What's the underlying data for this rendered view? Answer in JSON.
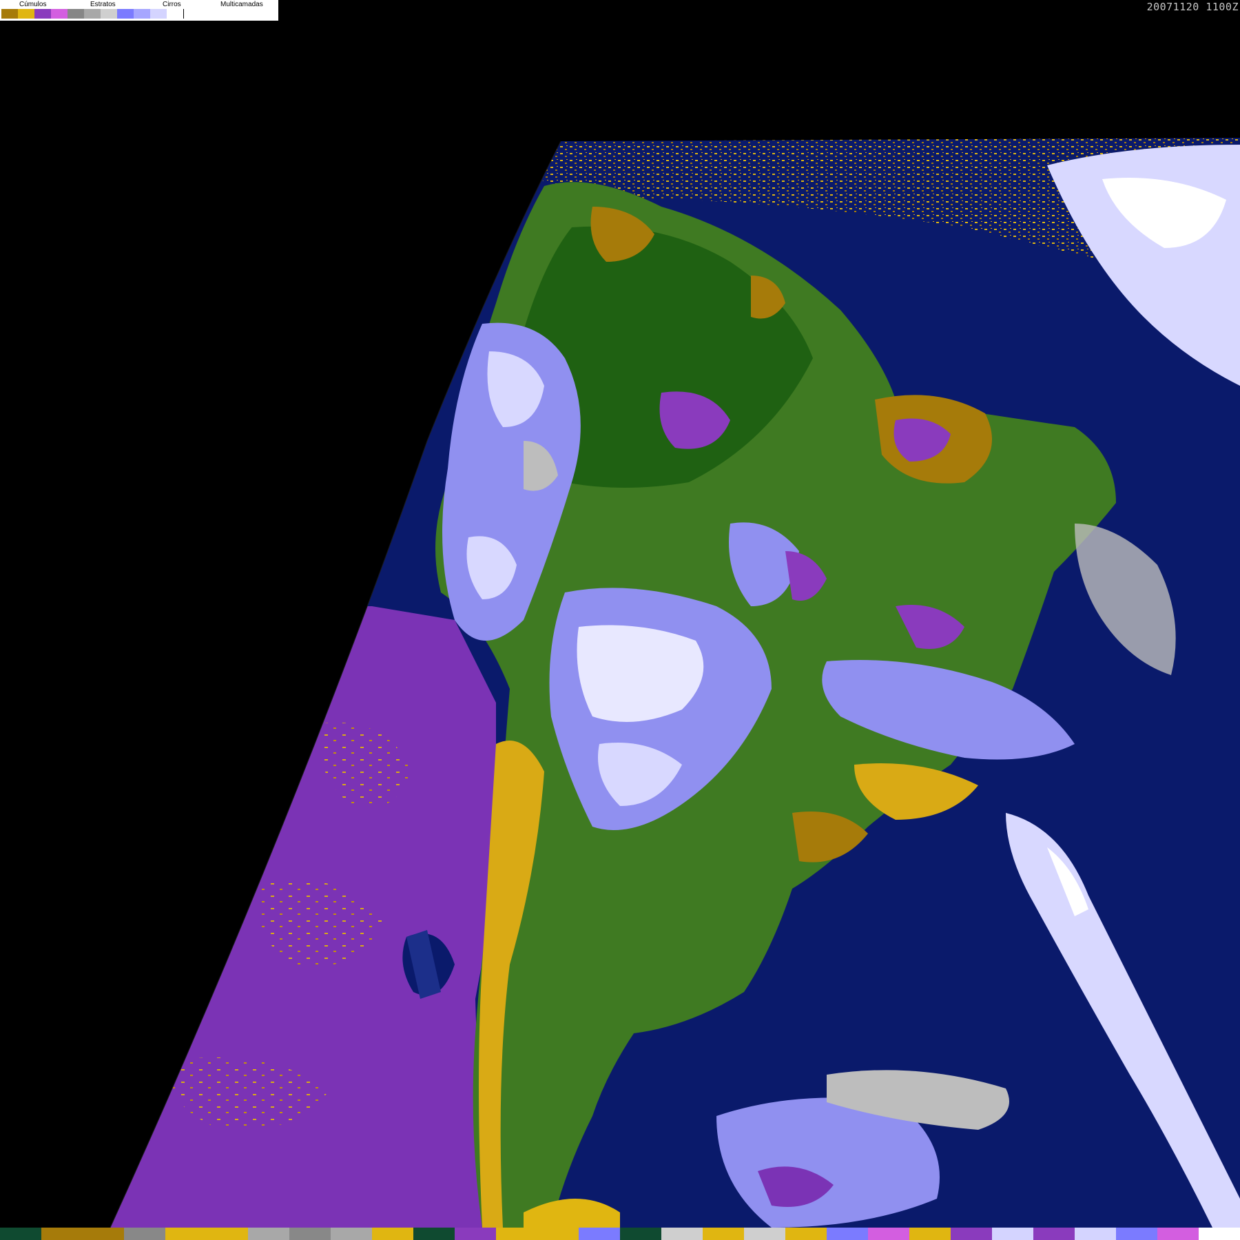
{
  "legend": {
    "categories": [
      {
        "label": "Cúmulos",
        "colors": [
          "#a67b0a",
          "#e0b611"
        ]
      },
      {
        "label": "Estratos",
        "colors": [
          "#8a3bbd",
          "#d35ee0"
        ]
      },
      {
        "label": "Cirros",
        "colors": [
          "#868686",
          "#a8a8a8",
          "#cfcfcf"
        ]
      },
      {
        "label": "Multicamadas",
        "colors": [
          "#7b7bff",
          "#a6a6ff",
          "#d4d4ff",
          "#ffffff"
        ]
      }
    ]
  },
  "timestamp": "20071120 1100Z",
  "colors": {
    "background": "#000000",
    "ocean": "#0a1a6b",
    "land": "#3f7a22",
    "land_dark": "#1f6112",
    "stratus_ocean": "#7b33b5",
    "cumulus": "#d9aa15",
    "cumulus_dark": "#a67b0a",
    "multilayer_light": "#d8d8ff",
    "multilayer_mid": "#9090f0",
    "cirrus": "#bdbdbd"
  },
  "bottom_strip": [
    "#0f4a30",
    "#a67b0a",
    "#a67b0a",
    "#888888",
    "#e0b611",
    "#e0b611",
    "#a8a8a8",
    "#888888",
    "#a8a8a8",
    "#e0b611",
    "#0f4a30",
    "#8a3bbd",
    "#e0b611",
    "#e0b611",
    "#7b7bff",
    "#0f4a30",
    "#cfcfcf",
    "#e0b611",
    "#cfcfcf",
    "#e0b611",
    "#7b7bff",
    "#d35ee0",
    "#e0b611",
    "#8a3bbd",
    "#d4d4ff",
    "#8a3bbd",
    "#d4d4ff",
    "#7b7bff",
    "#d35ee0",
    "#ffffff"
  ]
}
